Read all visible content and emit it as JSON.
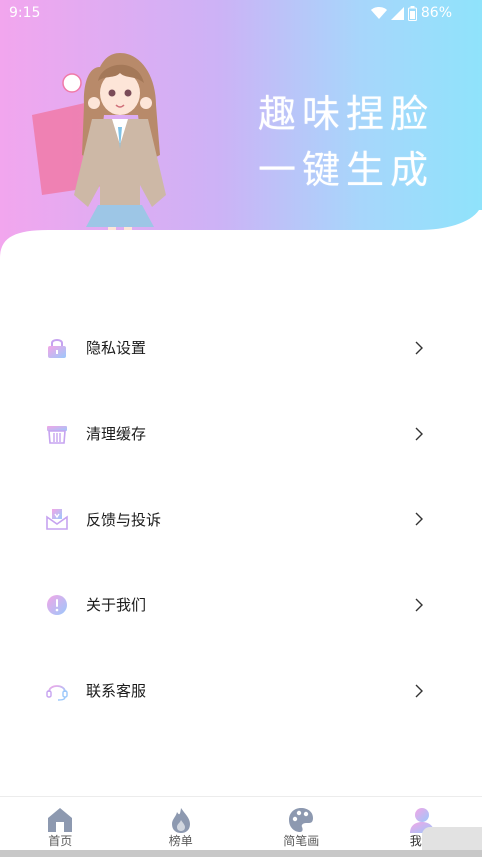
{
  "status_bar": {
    "time": "9:15",
    "battery": "86%",
    "icons": [
      "wifi-icon",
      "signal-icon",
      "battery-icon"
    ]
  },
  "hero": {
    "slogan_line1": "趣味捏脸",
    "slogan_line2": "一键生成",
    "gradient": [
      "#f2a6ee",
      "#8fe3fb"
    ]
  },
  "menu": {
    "items": [
      {
        "label": "隐私设置",
        "icon": "lock-icon"
      },
      {
        "label": "清理缓存",
        "icon": "broom-icon"
      },
      {
        "label": "反馈与投诉",
        "icon": "mail-icon"
      },
      {
        "label": "关于我们",
        "icon": "info-icon"
      },
      {
        "label": "联系客服",
        "icon": "headset-icon"
      }
    ]
  },
  "tabbar": {
    "tabs": [
      {
        "label": "首页",
        "icon": "home-icon"
      },
      {
        "label": "榜单",
        "icon": "fire-icon"
      },
      {
        "label": "简笔画",
        "icon": "palette-icon"
      },
      {
        "label": "我的",
        "icon": "user-icon",
        "active": true
      }
    ]
  }
}
